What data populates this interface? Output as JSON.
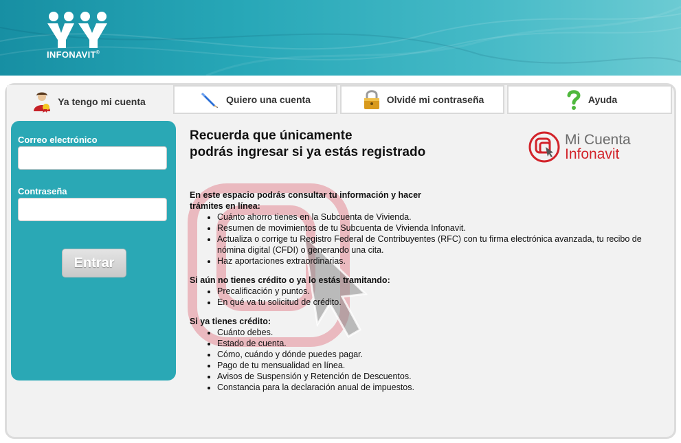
{
  "brand": {
    "logo_text": "INFONAVIT",
    "mark_text": "®"
  },
  "tabs": [
    {
      "label": "Ya tengo mi cuenta",
      "icon": "user-badge-icon",
      "active": true
    },
    {
      "label": "Quiero una cuenta",
      "icon": "pencil-icon",
      "active": false
    },
    {
      "label": "Olvidé mi contraseña",
      "icon": "padlock-icon",
      "active": false
    },
    {
      "label": "Ayuda",
      "icon": "question-mark-icon",
      "active": false
    }
  ],
  "login": {
    "email_label": "Correo electrónico",
    "email_value": "",
    "password_label": "Contraseña",
    "password_value": "",
    "submit_label": "Entrar"
  },
  "headline": {
    "line1": "Recuerda que únicamente",
    "line2": "podrás ingresar si ya estás registrado"
  },
  "product_logo": {
    "line1": "Mi Cuenta",
    "line2": "Infonavit"
  },
  "sections": [
    {
      "heading": "En este espacio podrás consultar tu información y hacer trámites en línea:",
      "items": [
        "Cuánto ahorro tienes en la Subcuenta de Vivienda.",
        "Resumen de movimientos de tu Subcuenta de Vivienda Infonavit.",
        "Actualiza o corrige tu Registro Federal de Contribuyentes (RFC) con tu firma electrónica avanzada, tu recibo de nómina digital (CFDI) o generando una cita.",
        "Haz aportaciones extraordinarias."
      ]
    },
    {
      "heading": "Si aún no tienes crédito o ya lo estás tramitando:",
      "items": [
        "Precalificación y puntos.",
        "En qué va tu solicitud de crédito."
      ]
    },
    {
      "heading": "Si ya tienes crédito:",
      "items": [
        "Cuánto debes.",
        "Estado de cuenta.",
        "Cómo, cuándo y dónde puedes pagar.",
        "Pago de tu mensualidad en línea.",
        "Avisos de Suspensión y Retención de Descuentos.",
        "Constancia para la declaración anual de impuestos."
      ]
    }
  ],
  "colors": {
    "teal": "#2aa8b5",
    "brand_red": "#d2232a",
    "panel_bg": "#f2f2f2"
  }
}
